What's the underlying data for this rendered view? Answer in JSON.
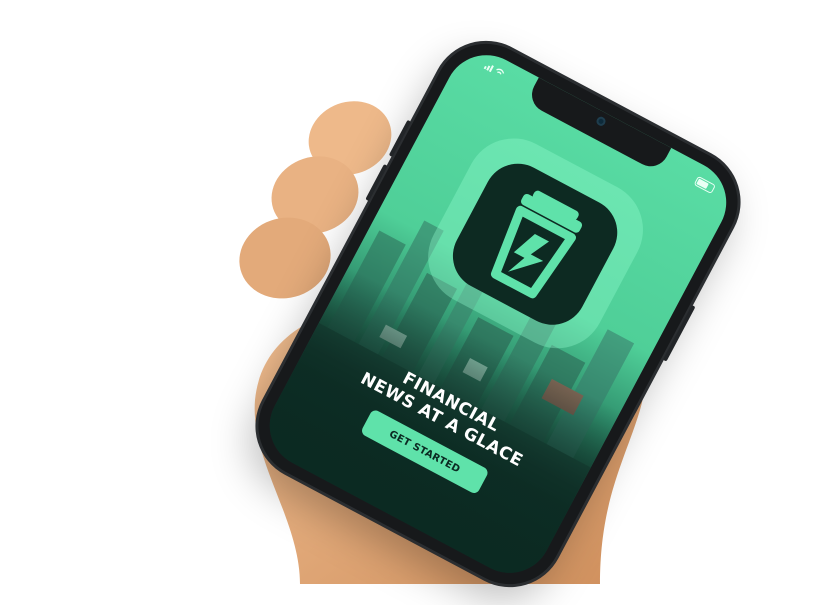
{
  "colors": {
    "accent": "#5fe2aa",
    "screen_top": "#59dca4",
    "screen_bottom": "#0b2a22",
    "icon_bg": "#0d2a22",
    "headline": "#ffffff"
  },
  "status_bar": {
    "signal_icon": "signal-icon",
    "wifi_icon": "wifi-icon",
    "battery_icon": "battery-icon"
  },
  "app": {
    "logo_icon": "cup-bolt-logo-icon"
  },
  "onboarding": {
    "headline_line1": "FINANCIAL",
    "headline_line2": "NEWS AT A GLACE",
    "cta_label": "GET STARTED"
  }
}
